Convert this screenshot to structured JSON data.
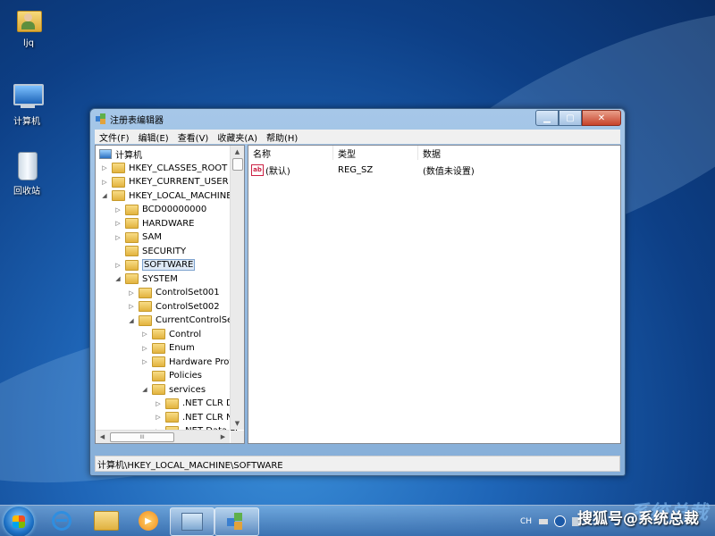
{
  "desktop": {
    "icons": [
      {
        "label": "ljq"
      },
      {
        "label": "计算机"
      },
      {
        "label": "回收站"
      }
    ]
  },
  "window": {
    "title": "注册表编辑器",
    "controls": {
      "minimize": "▁",
      "maximize": "▢",
      "close": "✕"
    }
  },
  "menu": [
    "文件(F)",
    "编辑(E)",
    "查看(V)",
    "收藏夹(A)",
    "帮助(H)"
  ],
  "tree": {
    "root": "计算机",
    "items": [
      {
        "label": "HKEY_CLASSES_ROOT",
        "level": 1,
        "state": "collapsed"
      },
      {
        "label": "HKEY_CURRENT_USER",
        "level": 1,
        "state": "collapsed"
      },
      {
        "label": "HKEY_LOCAL_MACHINE",
        "level": 1,
        "state": "expanded"
      },
      {
        "label": "BCD00000000",
        "level": 2,
        "state": "collapsed"
      },
      {
        "label": "HARDWARE",
        "level": 2,
        "state": "collapsed"
      },
      {
        "label": "SAM",
        "level": 2,
        "state": "collapsed"
      },
      {
        "label": "SECURITY",
        "level": 2,
        "state": "none"
      },
      {
        "label": "SOFTWARE",
        "level": 2,
        "state": "collapsed",
        "selected": true
      },
      {
        "label": "SYSTEM",
        "level": 2,
        "state": "expanded"
      },
      {
        "label": "ControlSet001",
        "level": 3,
        "state": "collapsed"
      },
      {
        "label": "ControlSet002",
        "level": 3,
        "state": "collapsed"
      },
      {
        "label": "CurrentControlSet",
        "level": 3,
        "state": "expanded"
      },
      {
        "label": "Control",
        "level": 4,
        "state": "collapsed"
      },
      {
        "label": "Enum",
        "level": 4,
        "state": "collapsed"
      },
      {
        "label": "Hardware Profil",
        "level": 4,
        "state": "collapsed"
      },
      {
        "label": "Policies",
        "level": 4,
        "state": "none"
      },
      {
        "label": "services",
        "level": 4,
        "state": "expanded"
      },
      {
        "label": ".NET CLR Da",
        "level": 5,
        "state": "collapsed"
      },
      {
        "label": ".NET CLR Ne",
        "level": 5,
        "state": "collapsed"
      },
      {
        "label": ".NET Data Pr",
        "level": 5,
        "state": "collapsed"
      }
    ]
  },
  "list": {
    "columns": [
      "名称",
      "类型",
      "数据"
    ],
    "rows": [
      {
        "icon": "ab",
        "name": "(默认)",
        "type": "REG_SZ",
        "data": "(数值未设置)"
      }
    ]
  },
  "statusbar": {
    "path": "计算机\\HKEY_LOCAL_MACHINE\\SOFTWARE"
  },
  "scroll": {
    "hthumb_label": "III"
  },
  "taskbar": {
    "tray_lang": "CH",
    "watermark": "搜狐号@系统总裁",
    "watermark_bg": "系统总裁"
  }
}
